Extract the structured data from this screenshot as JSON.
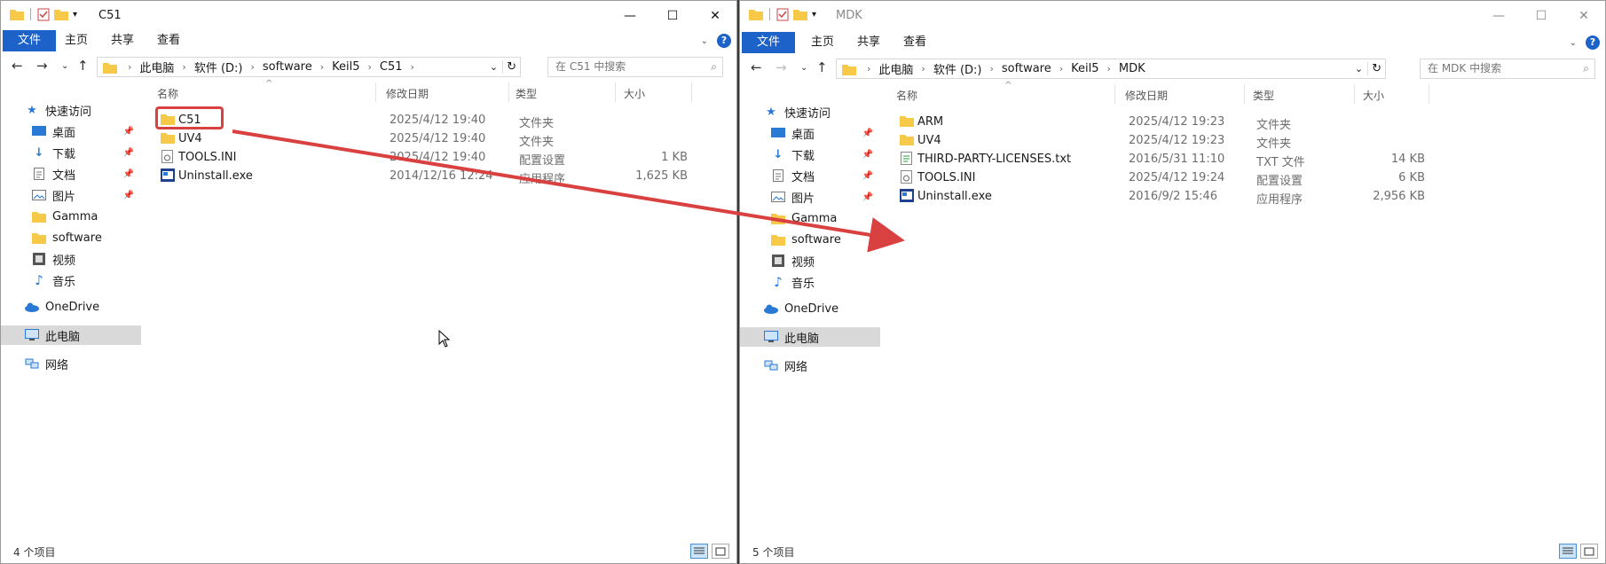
{
  "left": {
    "title": "C51",
    "ribbon_tabs": [
      "文件",
      "主页",
      "共享",
      "查看"
    ],
    "breadcrumb": [
      "此电脑",
      "软件 (D:)",
      "software",
      "Keil5",
      "C51"
    ],
    "search_placeholder": "在 C51 中搜索",
    "columns": {
      "name": "名称",
      "date": "修改日期",
      "type": "类型",
      "size": "大小"
    },
    "files": [
      {
        "name": "C51",
        "date": "2025/4/12 19:40",
        "type": "文件夹",
        "size": "",
        "icon": "folder-icon"
      },
      {
        "name": "UV4",
        "date": "2025/4/12 19:40",
        "type": "文件夹",
        "size": "",
        "icon": "folder-icon"
      },
      {
        "name": "TOOLS.INI",
        "date": "2025/4/12 19:40",
        "type": "配置设置",
        "size": "1 KB",
        "icon": "ini-file-icon"
      },
      {
        "name": "Uninstall.exe",
        "date": "2014/12/16 12:24",
        "type": "应用程序",
        "size": "1,625 KB",
        "icon": "exe-file-icon"
      }
    ],
    "status": "4 个项目"
  },
  "right": {
    "title": "MDK",
    "ribbon_tabs": [
      "文件",
      "主页",
      "共享",
      "查看"
    ],
    "breadcrumb": [
      "此电脑",
      "软件 (D:)",
      "software",
      "Keil5",
      "MDK"
    ],
    "search_placeholder": "在 MDK 中搜索",
    "columns": {
      "name": "名称",
      "date": "修改日期",
      "type": "类型",
      "size": "大小"
    },
    "files": [
      {
        "name": "ARM",
        "date": "2025/4/12 19:23",
        "type": "文件夹",
        "size": "",
        "icon": "folder-icon"
      },
      {
        "name": "UV4",
        "date": "2025/4/12 19:23",
        "type": "文件夹",
        "size": "",
        "icon": "folder-icon"
      },
      {
        "name": "THIRD-PARTY-LICENSES.txt",
        "date": "2016/5/31 11:10",
        "type": "TXT 文件",
        "size": "14 KB",
        "icon": "txt-file-icon"
      },
      {
        "name": "TOOLS.INI",
        "date": "2025/4/12 19:24",
        "type": "配置设置",
        "size": "6 KB",
        "icon": "ini-file-icon"
      },
      {
        "name": "Uninstall.exe",
        "date": "2016/9/2 15:46",
        "type": "应用程序",
        "size": "2,956 KB",
        "icon": "exe-file-icon"
      }
    ],
    "status": "5 个项目"
  },
  "sidebar": {
    "quick_access": "快速访问",
    "items": [
      "桌面",
      "下载",
      "文档",
      "图片",
      "Gamma",
      "software",
      "视频",
      "音乐"
    ],
    "onedrive": "OneDrive",
    "this_pc": "此电脑",
    "network": "网络"
  },
  "colors": {
    "accent": "#1d62c9",
    "annotation": "#d94040",
    "folder": "#f7c948"
  }
}
